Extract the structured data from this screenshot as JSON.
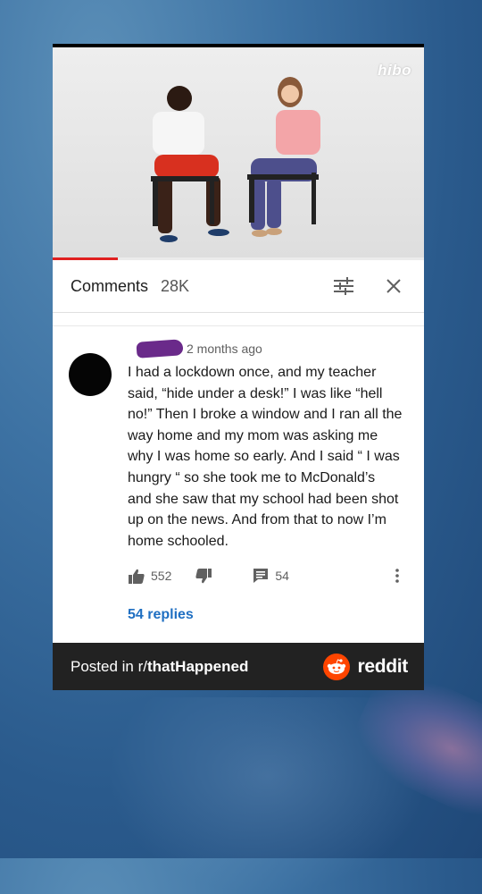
{
  "video": {
    "watermark": "hibo",
    "progress": 0.175,
    "colors": {
      "progress": "#e02020"
    }
  },
  "comments_header": {
    "title": "Comments",
    "count": "28K",
    "icons": [
      "filter-sliders-icon",
      "close-icon"
    ]
  },
  "comment": {
    "time": "2 months ago",
    "text": "I had a lockdown once, and my teacher said, “hide under a desk!” I was like “hell no!” Then I broke a window and I ran all the way home and my mom was asking me why I was home so early. And I said “ I was hungry “ so she took me to McDonald’s and she saw that my school had been shot up on the news. And from that to now I’m home schooled.",
    "likes": "552",
    "reply_count": "54",
    "replies_label": "54 replies",
    "icons": [
      "thumbs-up-icon",
      "thumbs-down-icon",
      "reply-icon",
      "more-vert-icon"
    ]
  },
  "footer": {
    "posted_prefix": "Posted in r/",
    "subreddit": "thatHappened",
    "brand": "reddit",
    "colors": {
      "brand": "#ff4500",
      "bar": "#222222"
    }
  },
  "colors": {
    "link": "#1f6fc2",
    "redaction": "#6a2a8a"
  }
}
